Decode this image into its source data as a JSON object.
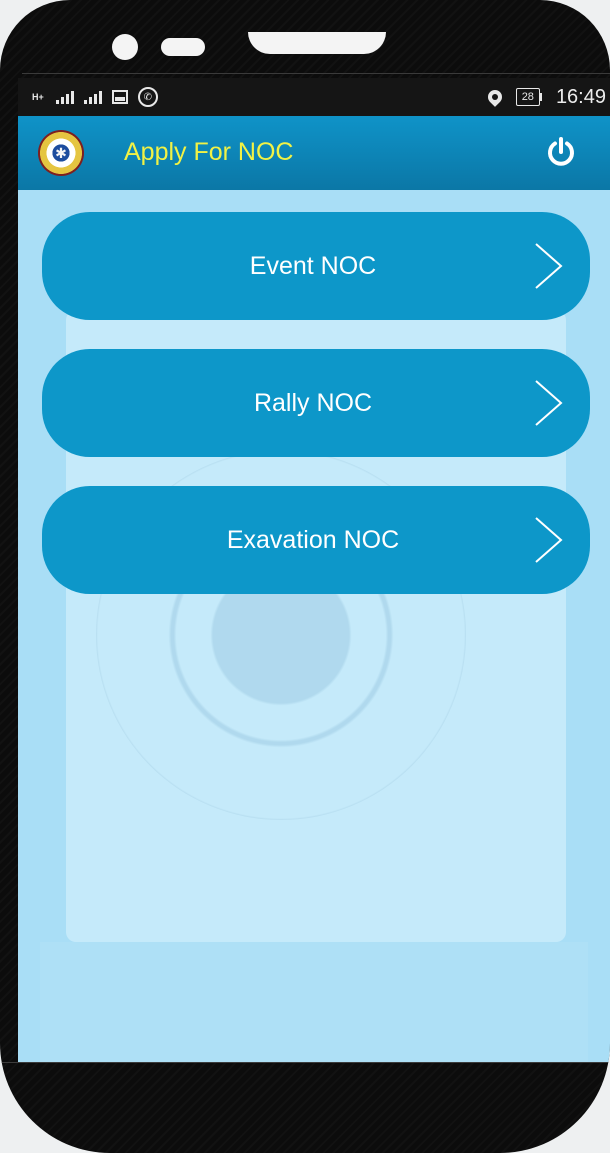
{
  "status_bar": {
    "network_type": "H+",
    "battery_level": "28",
    "time": "16:49"
  },
  "app_bar": {
    "title": "Apply For NOC",
    "logo_icon": "traffic-police-emblem-icon",
    "power_icon": "power-icon"
  },
  "noc_options": [
    {
      "label": "Event NOC",
      "icon": "chevron-right-icon"
    },
    {
      "label": "Rally NOC",
      "icon": "chevron-right-icon"
    },
    {
      "label": "Exavation NOC",
      "icon": "chevron-right-icon"
    }
  ],
  "colors": {
    "app_bar": "#0b83b6",
    "title_text": "#f1f245",
    "button": "#0d97c9",
    "background": "#a9def6"
  }
}
